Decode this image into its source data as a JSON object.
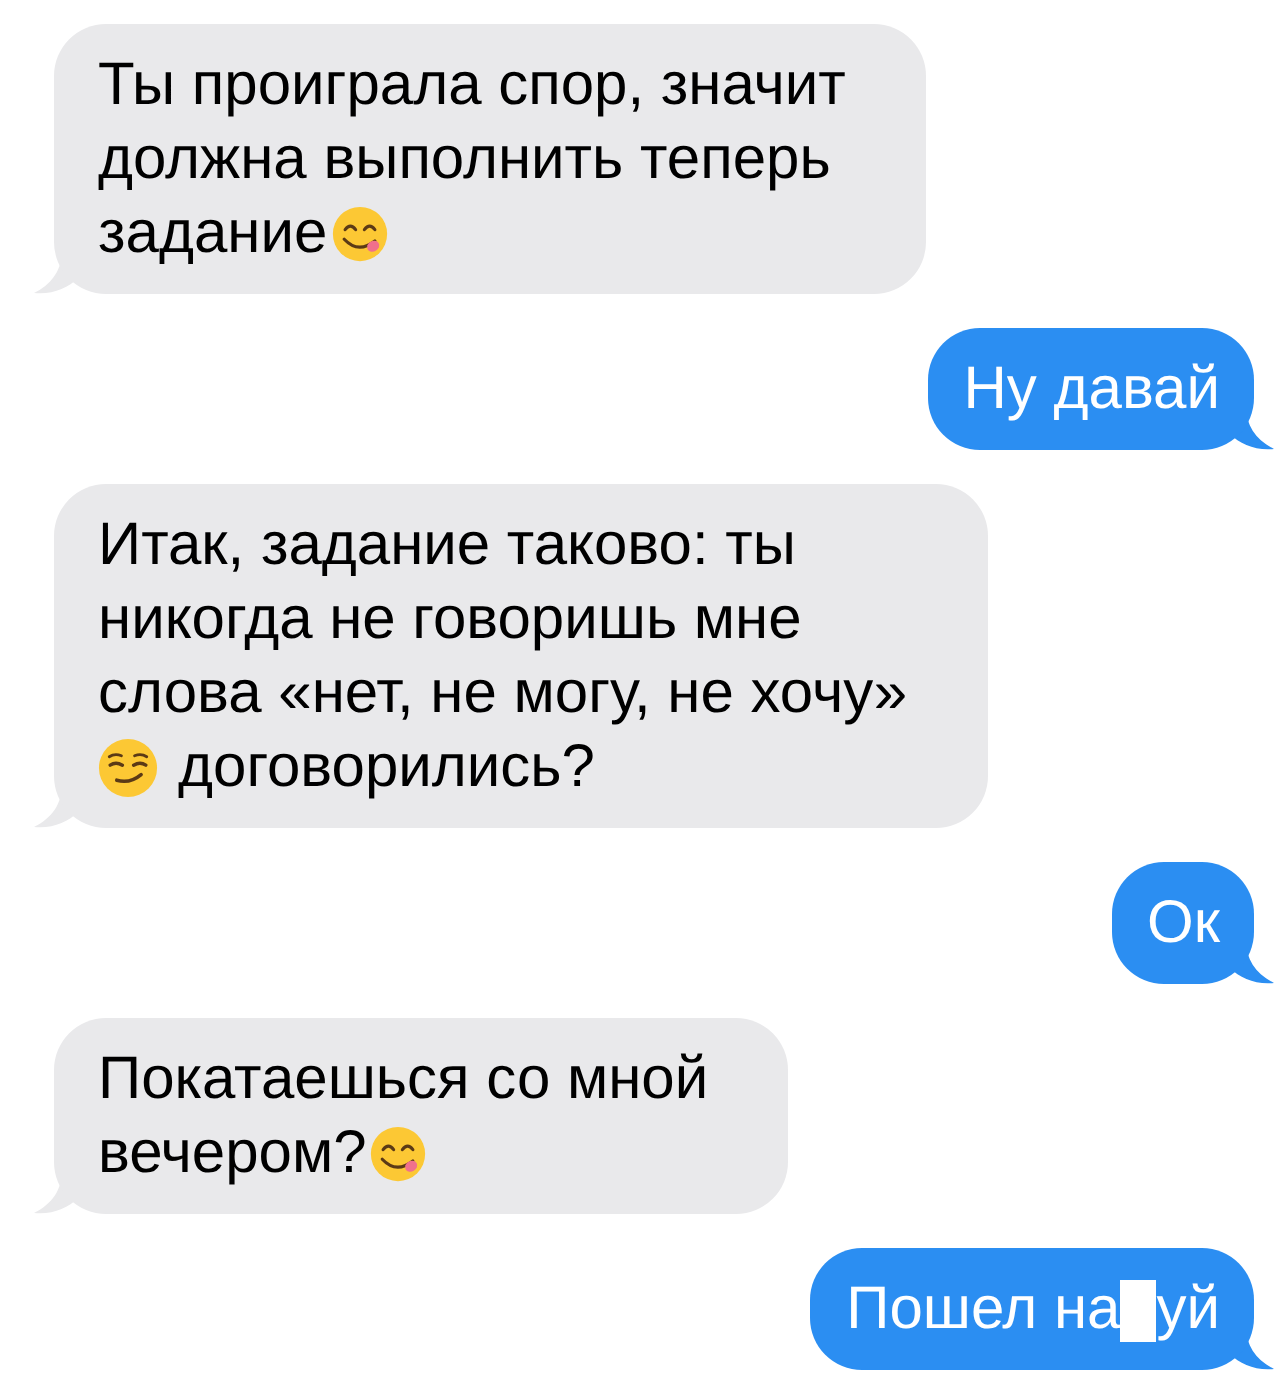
{
  "messages": [
    {
      "kind": "received",
      "rows": [
        [
          {
            "kind": "text",
            "lines": [
              "Ты проиграла спор, значит",
              "должна выполнить теперь"
            ]
          }
        ],
        [
          {
            "kind": "text",
            "lines": [
              "задание"
            ]
          },
          {
            "kind": "yum"
          }
        ]
      ]
    },
    {
      "kind": "sent",
      "rows": [
        [
          {
            "kind": "text",
            "lines": [
              "Ну давай"
            ]
          }
        ]
      ]
    },
    {
      "kind": "received",
      "rows": [
        [
          {
            "kind": "text",
            "lines": [
              "Итак, задание таково: ты",
              "никогда не говоришь мне",
              "слова «нет, не могу, не хочу»"
            ]
          }
        ],
        [
          {
            "kind": "smirk"
          },
          {
            "kind": "text",
            "lines": [
              "договорились?"
            ]
          }
        ]
      ]
    },
    {
      "kind": "sent",
      "rows": [
        [
          {
            "kind": "text",
            "lines": [
              "Ок"
            ]
          }
        ]
      ]
    },
    {
      "kind": "received",
      "rows": [
        [
          {
            "kind": "text",
            "lines": [
              "Покатаешься со мной"
            ]
          }
        ],
        [
          {
            "kind": "text",
            "lines": [
              "вечером?"
            ]
          },
          {
            "kind": "yum"
          }
        ]
      ]
    },
    {
      "kind": "sent",
      "rows": [
        [
          {
            "kind": "text",
            "lines": [
              "Пошел на"
            ]
          },
          {
            "kind": "censor"
          },
          {
            "kind": "text",
            "lines": [
              "уй"
            ]
          }
        ]
      ]
    }
  ]
}
